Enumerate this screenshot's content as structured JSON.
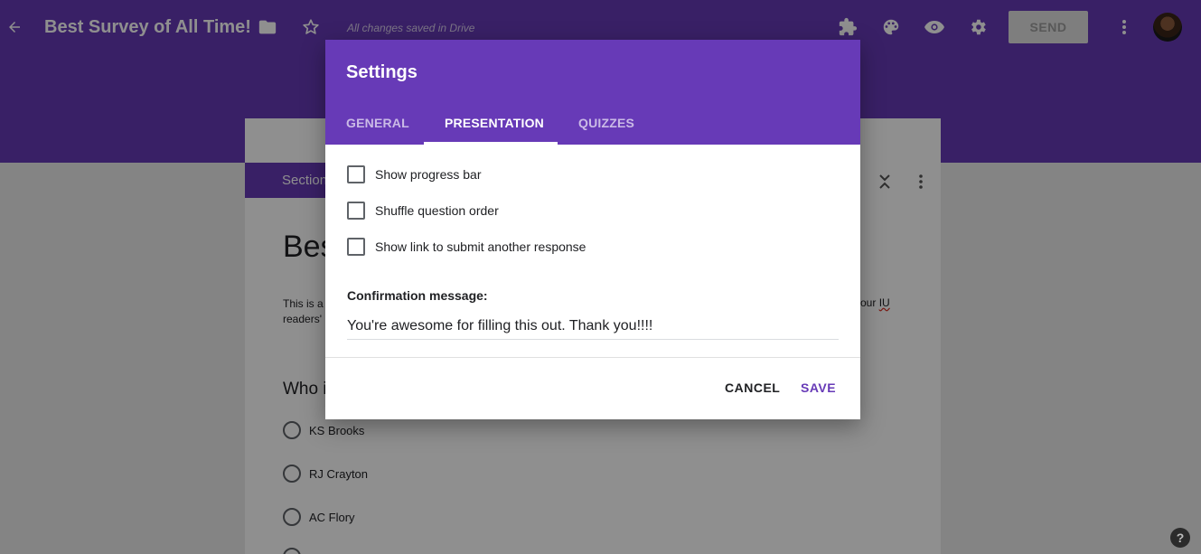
{
  "topbar": {
    "title": "Best Survey of All Time!",
    "saved_status": "All changes saved in Drive",
    "send_label": "SEND",
    "icons": [
      "back-arrow-icon",
      "folder-icon",
      "star-icon",
      "puzzle-icon",
      "palette-icon",
      "eye-icon",
      "gear-icon",
      "more-vert-icon"
    ]
  },
  "form": {
    "section_label": "Section",
    "title": "Bes",
    "description_line1": "This is a",
    "description_line2": "readers'",
    "description_right_prefix": "or our ",
    "description_right_word": "IU",
    "question_title": "Who i",
    "options": [
      "KS Brooks",
      "RJ Crayton",
      "AC Flory"
    ]
  },
  "dialog": {
    "title": "Settings",
    "tabs": [
      {
        "label": "GENERAL",
        "active": false
      },
      {
        "label": "PRESENTATION",
        "active": true
      },
      {
        "label": "QUIZZES",
        "active": false
      }
    ],
    "checkboxes": [
      {
        "label": "Show progress bar",
        "checked": false
      },
      {
        "label": "Shuffle question order",
        "checked": false
      },
      {
        "label": "Show link to submit another response",
        "checked": false
      }
    ],
    "confirmation_label": "Confirmation message:",
    "confirmation_value": "You're awesome for filling this out. Thank you!!!!",
    "cancel_label": "CANCEL",
    "save_label": "SAVE"
  },
  "help_label": "?",
  "colors": {
    "accent": "#673ab7",
    "scrim": "rgba(0,0,0,0.44)"
  }
}
